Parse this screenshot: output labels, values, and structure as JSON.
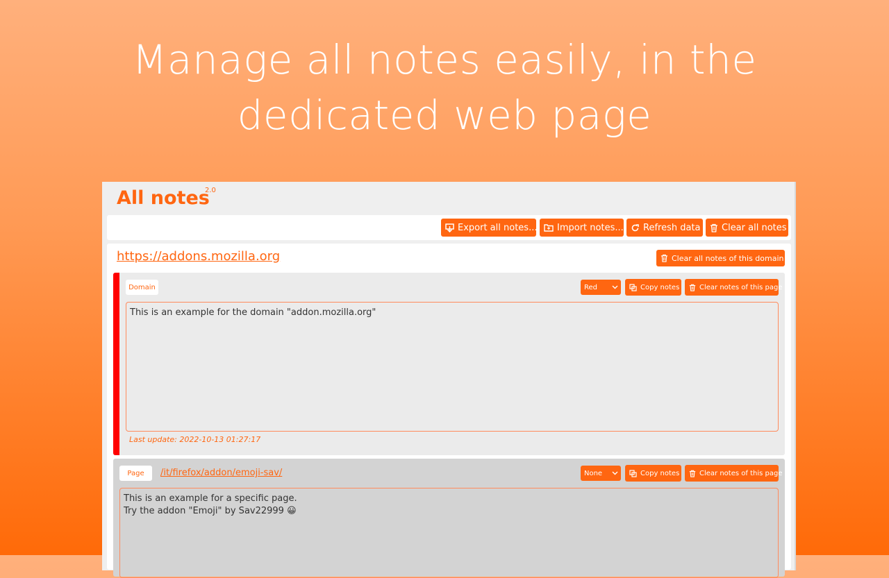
{
  "headline": {
    "line1": "Manage all notes easily, in the",
    "line2": "dedicated web page"
  },
  "app": {
    "title": "All notes",
    "version": "2.0"
  },
  "toolbar": {
    "export_label": "Export all notes...",
    "import_label": "Import notes...",
    "refresh_label": "Refresh data",
    "clear_all_label": "Clear all notes"
  },
  "domain": {
    "url": "https://addons.mozilla.org",
    "clear_domain_label": "Clear all notes of this domain",
    "notes": [
      {
        "type": "Domain",
        "color_value": "Red",
        "copy_label": "Copy notes",
        "clear_label": "Clear notes of this page",
        "text": "This is an example for the domain \"addon.mozilla.org\"",
        "last_update": "Last update: 2022-10-13 01:27:17"
      },
      {
        "type": "Page",
        "path": "/it/firefox/addon/emoji-sav/",
        "color_value": "None",
        "copy_label": "Copy notes",
        "clear_label": "Clear notes of this page",
        "text": "This is an example for a specific page.\nTry the addon \"Emoji\" by Sav22999 😀"
      }
    ]
  },
  "colors": {
    "accent": "#ff6611",
    "card_border_red": "#ff0000"
  }
}
